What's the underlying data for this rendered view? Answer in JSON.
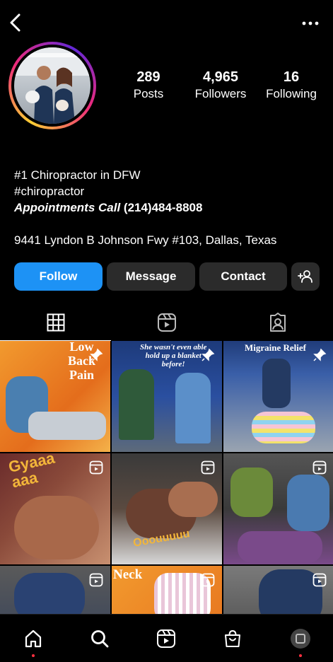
{
  "profile": {
    "stats": [
      {
        "value": "289",
        "label": "Posts"
      },
      {
        "value": "4,965",
        "label": "Followers"
      },
      {
        "value": "16",
        "label": "Following"
      }
    ],
    "bio": {
      "line1": "#1 Chiropractor in DFW",
      "line2": "#chiropractor",
      "appointments_label": "Appointments Call",
      "phone": "(214)484-8808",
      "address": "9441 Lyndon B Johnson Fwy #103, Dallas, Texas"
    }
  },
  "actions": {
    "follow": "Follow",
    "message": "Message",
    "contact": "Contact"
  },
  "tabs": [
    "grid-icon",
    "reels-icon",
    "tagged-icon"
  ],
  "grid": {
    "posts": [
      {
        "caption": "Low\nBack\nPain",
        "badge": "pin-icon"
      },
      {
        "caption": "She wasn't even able\nhold up a blanket\nbefore!",
        "badge": "pin-icon"
      },
      {
        "caption": "Migraine Relief",
        "badge": "pin-icon"
      },
      {
        "caption": "Gyaaa\naaa",
        "badge": "reel-icon"
      },
      {
        "caption": "Ooouuuuu",
        "badge": "reel-icon"
      },
      {
        "caption": "",
        "badge": "reel-icon"
      },
      {
        "caption": "",
        "badge": "reel-icon"
      },
      {
        "caption": "Neck",
        "badge": "reel-icon"
      },
      {
        "caption": "",
        "badge": "reel-icon"
      }
    ]
  },
  "colors": {
    "follow_blue": "#1d92f5",
    "button_gray": "#2b2b2b",
    "notification_red": "#ff3040"
  },
  "bottom_nav": [
    "home-icon",
    "search-icon",
    "reels-icon",
    "shop-icon",
    "profile-icon"
  ]
}
